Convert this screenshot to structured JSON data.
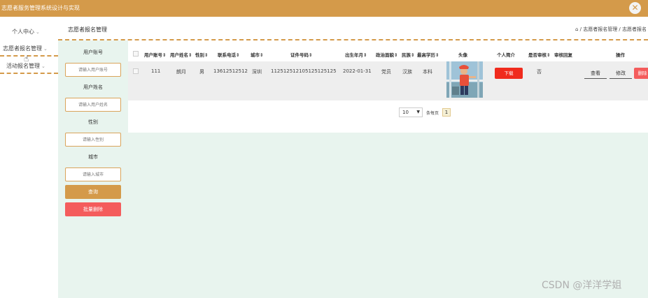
{
  "app": {
    "title": "志愿者服务管理系统设计与实现"
  },
  "sidebar": {
    "items": [
      {
        "label": "个人中心"
      },
      {
        "label": "志愿者报名管理"
      },
      {
        "label": "活动报名管理"
      }
    ]
  },
  "header": {
    "page_title": "志愿者报名管理",
    "breadcrumb": "⌂ / 志愿者报名管理 / 志愿者报名"
  },
  "filters": {
    "fields": [
      {
        "label": "用户账号",
        "placeholder": "请输入用户账号"
      },
      {
        "label": "用户姓名",
        "placeholder": "请输入用户姓名"
      },
      {
        "label": "性别",
        "placeholder": "请输入性别"
      },
      {
        "label": "城市",
        "placeholder": "请输入城市"
      }
    ],
    "query_label": "查询",
    "batch_delete_label": "批量删除"
  },
  "table": {
    "columns": [
      "用户账号⇕",
      "用户姓名⇕",
      "性别⇕",
      "联系电话⇕",
      "城市⇕",
      "证件号码⇕",
      "出生年月⇕",
      "政治面貌⇕",
      "民族⇕",
      "最高学历⇕",
      "头像",
      "个人简介",
      "是否审核⇕",
      "审核回复",
      "操作"
    ],
    "rows": [
      {
        "account": "111",
        "name": "朗月",
        "gender": "男",
        "phone": "13612512512",
        "city": "深圳",
        "id_number": "112512512105125125125",
        "birth": "2022-01-31",
        "political": "党员",
        "ethnicity": "汉族",
        "education": "本科",
        "download_label": "下载",
        "reviewed": "否",
        "reply": "",
        "view_label": "查看",
        "edit_label": "修改",
        "delete_label": "删除"
      }
    ]
  },
  "pagination": {
    "page_size": "10",
    "per_page_label": "条每页",
    "current_page": "1"
  },
  "watermark": "CSDN @洋洋学姐",
  "colors": {
    "accent": "#d49a4a",
    "danger": "#f45c5c",
    "content_bg": "#e8f4ee"
  }
}
